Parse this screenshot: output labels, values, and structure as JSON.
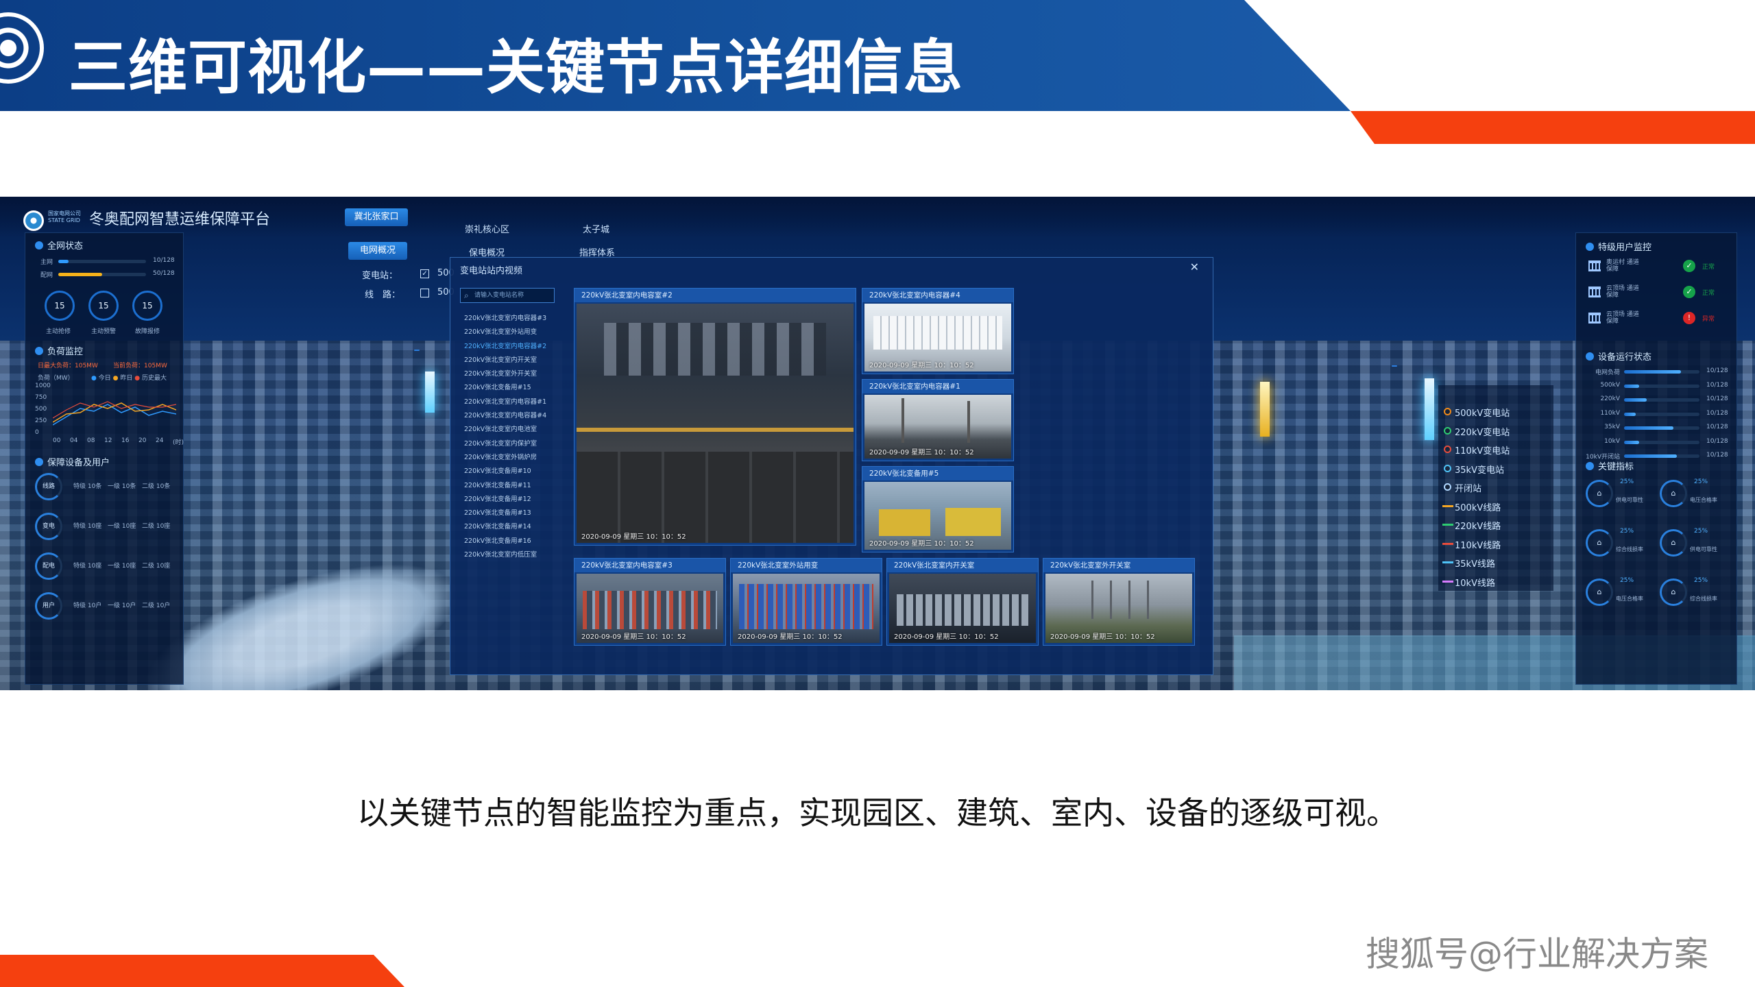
{
  "slide": {
    "title": "三维可视化——关键节点详细信息",
    "caption": "以关键节点的智能监控为重点，实现园区、建筑、室内、设备的逐级可视。",
    "watermark": "搜狐号@行业解决方案"
  },
  "colors": {
    "header_blue": "#14529e",
    "accent_orange": "#f5400f",
    "panel_bg": "#05163a",
    "highlight": "#4fb0ff"
  },
  "platform": {
    "org": "国家电网公司 STATE GRID",
    "name": "冬奥配网智慧运维保障平台",
    "buttons": {
      "region": "冀北张家口",
      "grid_overview": "电网概况"
    },
    "top_items": [
      "崇礼核心区",
      "太子城",
      "保电概况",
      "指挥体系"
    ],
    "filter": {
      "substation_label": "变电站：",
      "line_label": "线　路：",
      "substation_value": "500",
      "line_value": "500"
    }
  },
  "left_panel": {
    "overall": {
      "title": "全网状态",
      "rows": [
        {
          "label": "主网",
          "value": "10/128",
          "fraction": 0.12,
          "color": "#2f9bff"
        },
        {
          "label": "配网",
          "value": "50/128",
          "fraction": 0.5,
          "color": "#f5b21a"
        }
      ],
      "gauges": [
        {
          "value": "15",
          "label": "主动抢修"
        },
        {
          "value": "15",
          "label": "主动预警"
        },
        {
          "value": "15",
          "label": "故障报修"
        }
      ]
    },
    "load": {
      "title": "负荷监控",
      "max_today": "日最大负荷：105MW",
      "current": "当前负荷：105MW",
      "unit": "负荷（MW）",
      "legend": [
        "今日",
        "昨日",
        "历史最大"
      ],
      "y_ticks": [
        "1000",
        "750",
        "500",
        "250",
        "0"
      ],
      "x_ticks": [
        "00",
        "04",
        "08",
        "12",
        "16",
        "20",
        "24",
        "(时)"
      ]
    },
    "users": {
      "title": "保障设备及用户",
      "rings": [
        {
          "label": "线路",
          "stats": [
            "特级 10条",
            "一级 10条",
            "二级 10条"
          ]
        },
        {
          "label": "变电",
          "stats": [
            "特级 10座",
            "一级 10座",
            "二级 10座"
          ]
        },
        {
          "label": "配电",
          "stats": [
            "特级 10座",
            "一级 10座",
            "二级 10座"
          ]
        },
        {
          "label": "用户",
          "stats": [
            "特级 10户",
            "一级 10户",
            "二级 10户"
          ]
        }
      ]
    }
  },
  "modal": {
    "title": "变电站站内视频",
    "close": "✕",
    "search_placeholder": "请输入变电站名称",
    "list": [
      "220kV张北变室内电容器#3",
      "220kV张北变室外站用变",
      "220kV张北变室内电容器#2",
      "220kV张北变室内开关室",
      "220kV张北变室外开关室",
      "220kV张北变备用#15",
      "220kV张北变室内电容器#1",
      "220kV张北变室内电容器#4",
      "220kV张北变室内电池室",
      "220kV张北变室内保护室",
      "220kV张北变室外锅炉房",
      "220kV张北变备用#10",
      "220kV张北变备用#11",
      "220kV张北变备用#12",
      "220kV张北变备用#13",
      "220kV张北变备用#14",
      "220kV张北变备用#16",
      "220kV张北变室内低压室"
    ],
    "active_index": 2,
    "cameras": {
      "main": {
        "title": "220kV张北变室内电容室#2",
        "time": "2020-09-09 星期三 10：10：52"
      },
      "r1": {
        "title": "220kV张北变室内电容器#4",
        "time": "2020-09-09 星期三 10：10：52"
      },
      "r2": {
        "title": "220kV张北变室内电容器#1",
        "time": "2020-09-09 星期三 10：10：52"
      },
      "r3": {
        "title": "220kV张北变备用#5",
        "time": "2020-09-09 星期三 10：10：52"
      },
      "b1": {
        "title": "220kV张北变室内电容室#3",
        "time": "2020-09-09 星期三 10：10：52"
      },
      "b2": {
        "title": "220kV张北变室外站用变",
        "time": "2020-09-09 星期三 10：10：52"
      },
      "b3": {
        "title": "220kV张北变室内开关室",
        "time": "2020-09-09 星期三 10：10：52"
      },
      "b4": {
        "title": "220kV张北变室外开关室",
        "time": "2020-09-09 星期三 10：10：52"
      }
    }
  },
  "legend": {
    "items": [
      {
        "label": "500kV变电站",
        "color": "#f08a1a",
        "kind": "dot"
      },
      {
        "label": "220kV变电站",
        "color": "#2ecc71",
        "kind": "dot"
      },
      {
        "label": "110kV变电站",
        "color": "#e74c3c",
        "kind": "dot"
      },
      {
        "label": "35kV变电站",
        "color": "#4fc3f7",
        "kind": "dot"
      },
      {
        "label": "开闭站",
        "color": "#b0d8ff",
        "kind": "dot"
      },
      {
        "label": "500kV线路",
        "color": "#f5a623",
        "kind": "line"
      },
      {
        "label": "220kV线路",
        "color": "#2ecc71",
        "kind": "line"
      },
      {
        "label": "110kV线路",
        "color": "#e74c3c",
        "kind": "line"
      },
      {
        "label": "35kV线路",
        "color": "#4fc3f7",
        "kind": "line"
      },
      {
        "label": "10kV线路",
        "color": "#d77cff",
        "kind": "line"
      }
    ]
  },
  "right_panel": {
    "special_users": {
      "title": "特级用户监控",
      "items": [
        {
          "name": "奥运村 通道保障",
          "status": "正常",
          "color": "#16a34a"
        },
        {
          "name": "云顶场 通道保障",
          "status": "正常",
          "color": "#16a34a"
        },
        {
          "name": "云顶场 通道保障",
          "status": "异常",
          "color": "#dc2626"
        }
      ]
    },
    "equipment": {
      "title": "设备运行状态",
      "rows": [
        {
          "label": "电网负荷",
          "value": "10/128",
          "fraction": 0.75
        },
        {
          "label": "500kV",
          "value": "10/128",
          "fraction": 0.2
        },
        {
          "label": "220kV",
          "value": "10/128",
          "fraction": 0.3
        },
        {
          "label": "110kV",
          "value": "10/128",
          "fraction": 0.15
        },
        {
          "label": "35kV",
          "value": "10/128",
          "fraction": 0.65
        },
        {
          "label": "10kV",
          "value": "10/128",
          "fraction": 0.2
        },
        {
          "label": "10kV开闭站",
          "value": "10/128",
          "fraction": 0.7
        }
      ]
    },
    "kpi": {
      "title": "关键指标",
      "items": [
        {
          "label": "供电可靠性",
          "value": "25%"
        },
        {
          "label": "电压合格率",
          "value": "25%"
        },
        {
          "label": "综合线损率",
          "value": "25%"
        },
        {
          "label": "供电可靠性",
          "value": "25%"
        },
        {
          "label": "电压合格率",
          "value": "25%"
        },
        {
          "label": "综合线损率",
          "value": "25%"
        }
      ]
    }
  }
}
